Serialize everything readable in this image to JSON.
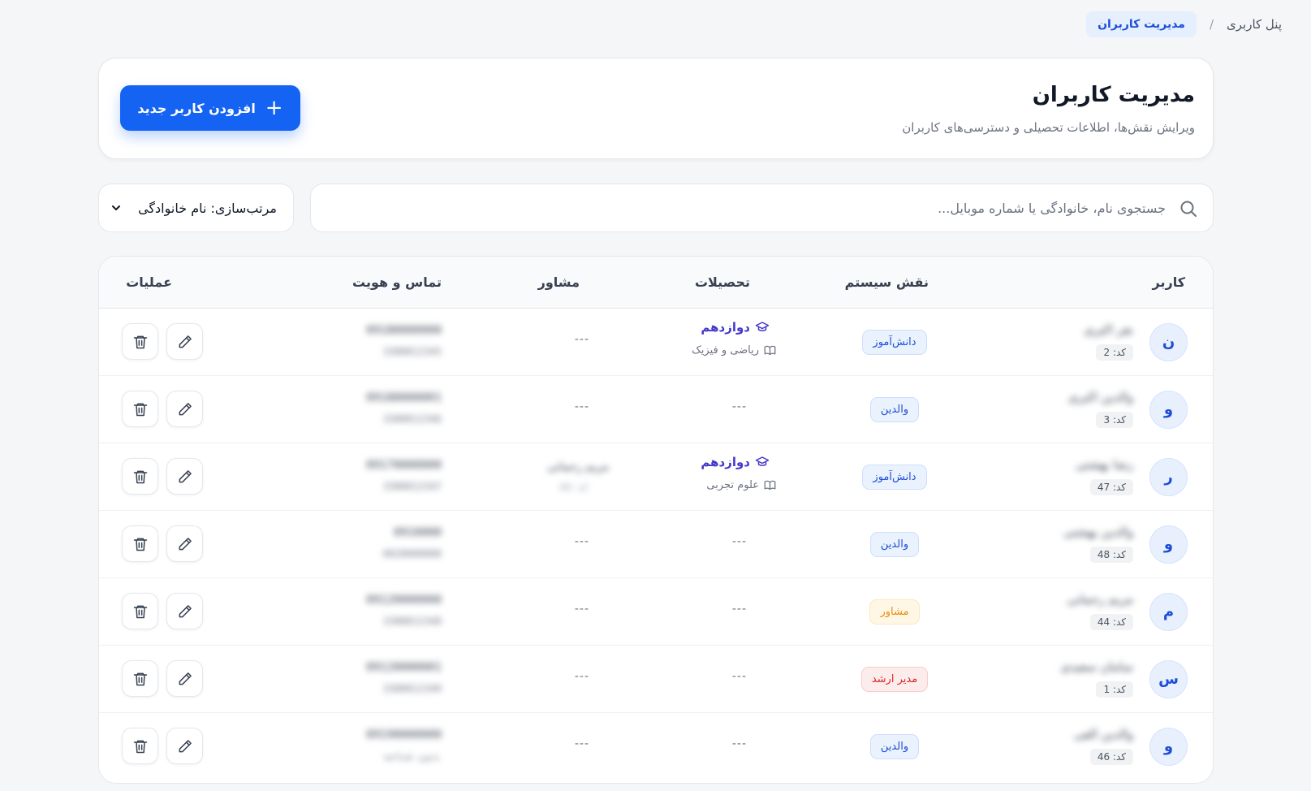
{
  "breadcrumb": {
    "root": "پنل کاربری",
    "separator": "/",
    "current": "مدیریت کاربران"
  },
  "header": {
    "title": "مدیریت کاربران",
    "subtitle": "ویرایش نقش‌ها، اطلاعات تحصیلی و دسترسی‌های کاربران",
    "add_button": "افزودن کاربر جدید",
    "add_icon": "plus-icon"
  },
  "search": {
    "placeholder": "جستجوی نام، خانوادگی یا شماره موبایل..."
  },
  "sort": {
    "label": "مرتب‌سازی: نام خانوادگی"
  },
  "colors": {
    "primary": "#1463f3",
    "student": "#1d4ed8",
    "counselor": "#ea8a0c",
    "admin": "#dc2626",
    "grade": "#4338ca"
  },
  "table": {
    "columns": {
      "user": "کاربر",
      "role": "نقش سیستم",
      "education": "تحصیلات",
      "counselor": "مشاور",
      "contact": "تماس و هویت",
      "actions": "عملیات"
    },
    "rows": [
      {
        "initial": "ن",
        "name": "نفر اکبری",
        "code": "کد: 2",
        "role": "دانش‌آموز",
        "role_type": "student",
        "grade": "دوازدهم",
        "field": "ریاضی و فیزیک",
        "counselor": "---",
        "phone": "09180000000",
        "national_id": "3300012345"
      },
      {
        "initial": "و",
        "name": "والدین اکبری",
        "code": "کد: 3",
        "role": "والدین",
        "role_type": "parent",
        "grade": "",
        "field": "",
        "education_empty": "---",
        "counselor": "---",
        "phone": "09180000001",
        "national_id": "3300012346"
      },
      {
        "initial": "ر",
        "name": "رضا بهشتی",
        "code": "کد: 47",
        "role": "دانش‌آموز",
        "role_type": "student",
        "grade": "دوازدهم",
        "field": "علوم تجربی",
        "counselor": "",
        "counselor_name": "مریم رحمانی",
        "counselor_sub": "کد: 44",
        "phone": "09170000000",
        "national_id": "3300012347"
      },
      {
        "initial": "و",
        "name": "والدین بهشتی",
        "code": "کد: 48",
        "role": "والدین",
        "role_type": "parent",
        "grade": "",
        "field": "",
        "education_empty": "---",
        "counselor": "---",
        "phone": "0910000",
        "national_id": "0020000000"
      },
      {
        "initial": "م",
        "name": "مریم رحمانی",
        "code": "کد: 44",
        "role": "مشاور",
        "role_type": "counselor",
        "grade": "",
        "field": "",
        "education_empty": "---",
        "counselor": "---",
        "phone": "09120000000",
        "national_id": "3300012348"
      },
      {
        "initial": "س",
        "name": "سامان سعیدی",
        "code": "کد: 1",
        "role": "مدیر ارشد",
        "role_type": "admin",
        "grade": "",
        "field": "",
        "education_empty": "---",
        "counselor": "---",
        "phone": "09120000001",
        "national_id": "3300012349"
      },
      {
        "initial": "و",
        "name": "والدین الفی",
        "code": "کد: 46",
        "role": "والدین",
        "role_type": "parent",
        "grade": "",
        "field": "",
        "education_empty": "---",
        "counselor": "---",
        "phone": "09190000000",
        "national_id": "بدون شناسه"
      }
    ]
  }
}
